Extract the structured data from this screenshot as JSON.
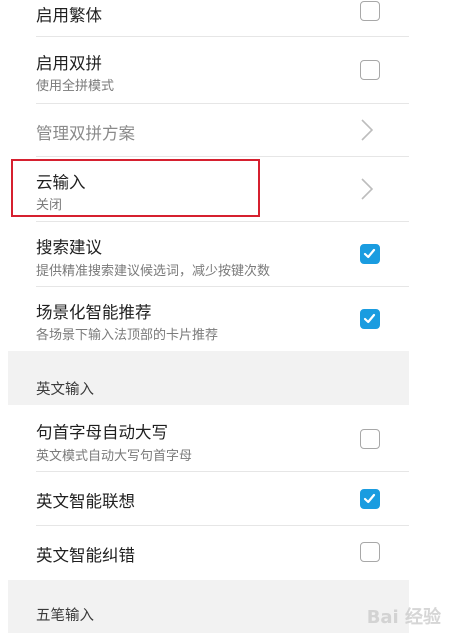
{
  "settings": {
    "traditional": {
      "title": "启用繁体",
      "checked": false
    },
    "double_pinyin": {
      "title": "启用双拼",
      "subtitle": "使用全拼模式",
      "checked": false
    },
    "manage_double_pinyin": {
      "title": "管理双拼方案",
      "icon": "chevron-right-icon"
    },
    "cloud_input": {
      "title": "云输入",
      "subtitle": "关闭",
      "icon": "chevron-right-icon"
    },
    "search_suggest": {
      "title": "搜索建议",
      "subtitle": "提供精准搜索建议候选词，减少按键次数",
      "checked": true
    },
    "scene_recommend": {
      "title": "场景化智能推荐",
      "subtitle": "各场景下输入法顶部的卡片推荐",
      "checked": true
    }
  },
  "sections": {
    "english": "英文输入",
    "wubi": "五笔输入"
  },
  "english": {
    "auto_capital": {
      "title": "句首字母自动大写",
      "subtitle": "英文模式自动大写句首字母",
      "checked": false
    },
    "smart_assoc": {
      "title": "英文智能联想",
      "checked": true
    },
    "smart_correct": {
      "title": "英文智能纠错",
      "checked": false
    }
  },
  "colors": {
    "accent": "#1a9ce0",
    "highlight_border": "#d6202f",
    "section_bg": "#f2f2f2"
  },
  "watermark": "Bai 经验"
}
